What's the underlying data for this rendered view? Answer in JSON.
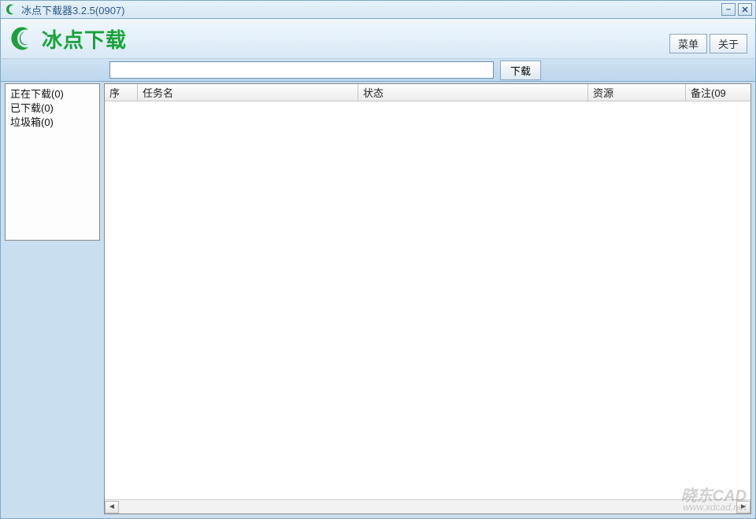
{
  "window": {
    "title": "冰点下载器3.2.5(0907)"
  },
  "header": {
    "brand_text": "冰点下载",
    "menu_label": "菜单",
    "about_label": "关于"
  },
  "toolbar": {
    "url_value": "",
    "url_placeholder": "",
    "download_label": "下载"
  },
  "sidebar": {
    "items": [
      {
        "label": "正在下载(0)"
      },
      {
        "label": "已下载(0)"
      },
      {
        "label": "垃圾箱(0)"
      }
    ]
  },
  "columns": {
    "seq": "序",
    "task": "任务名",
    "status": "状态",
    "resource": "资源",
    "note": "备注(09"
  },
  "watermark": {
    "line1": "晓东CAD",
    "line2": "www.xdcad.net"
  },
  "icons": {
    "minimize": "–",
    "close": "✕",
    "scroll_left": "◄",
    "scroll_right": "►"
  }
}
